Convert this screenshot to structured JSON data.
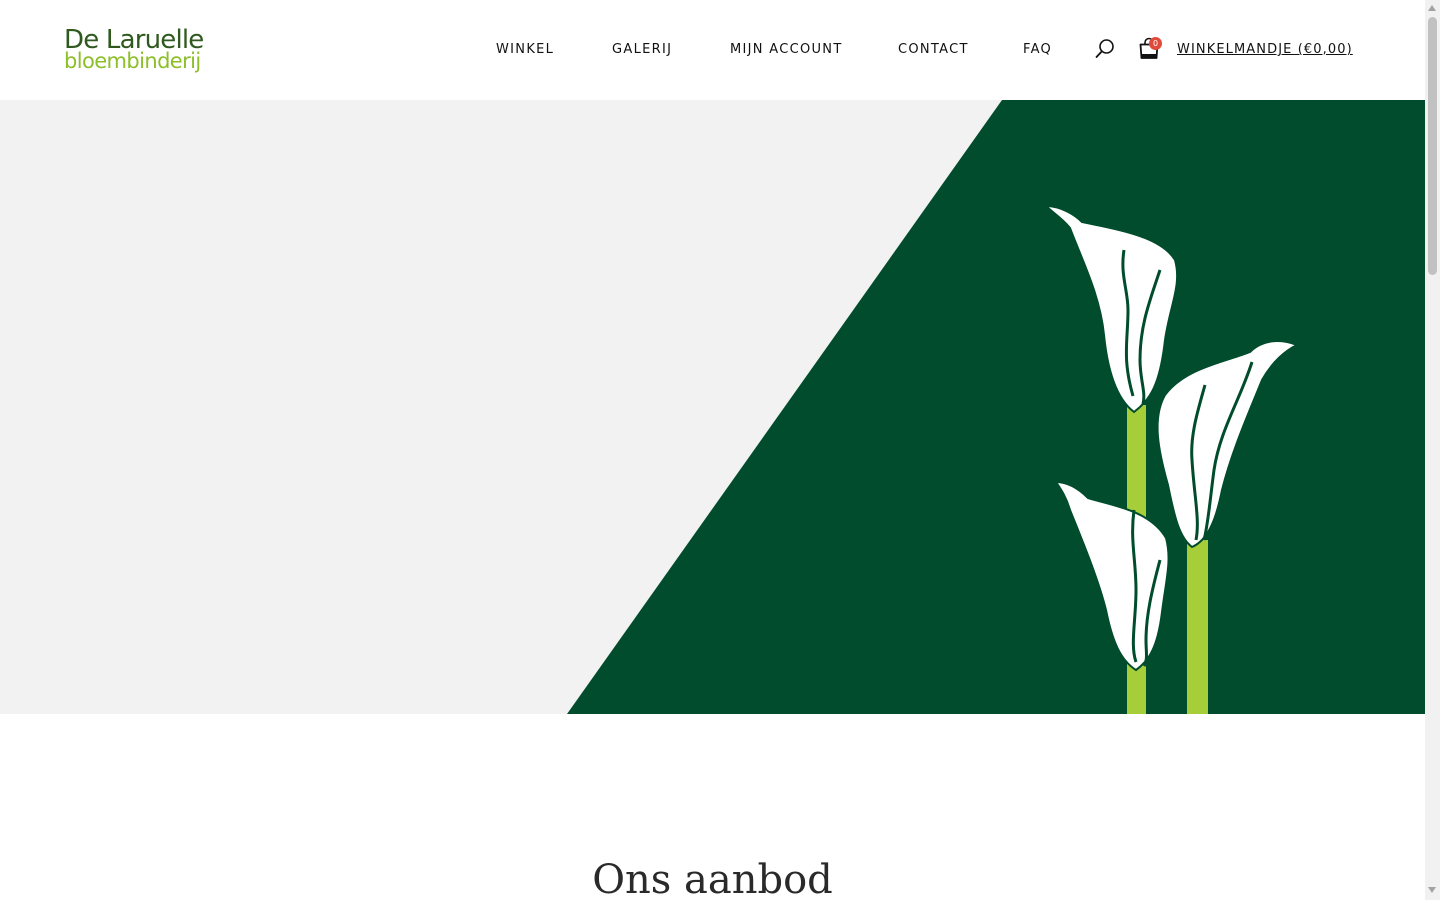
{
  "brand": {
    "name_line1": "De Laruelle",
    "name_line2": "bloembinderij"
  },
  "nav": {
    "items": [
      {
        "label": "WINKEL"
      },
      {
        "label": "GALERIJ"
      },
      {
        "label": "MIJN ACCOUNT"
      },
      {
        "label": "CONTACT"
      },
      {
        "label": "FAQ"
      }
    ],
    "search_icon": "search-icon",
    "cart": {
      "icon": "shopping-bag-icon",
      "count": "0",
      "label": "WINKELMANDJE (€0,00)"
    }
  },
  "hero": {
    "illustration": "calla-lilies",
    "colors": {
      "background": "#f2f2f2",
      "panel": "#004c2c",
      "stem": "#a6ce39",
      "flower": "#ffffff"
    }
  },
  "main": {
    "section_title": "Ons aanbod"
  },
  "colors": {
    "logo_dark": "#2f5a1f",
    "logo_light": "#8cbf2a",
    "badge": "#e04a3a"
  }
}
